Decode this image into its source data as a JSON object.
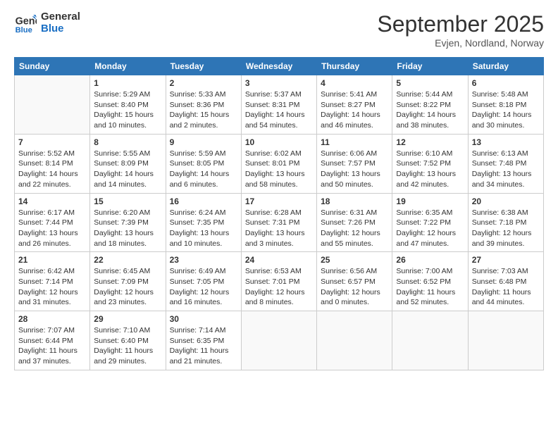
{
  "logo": {
    "text_general": "General",
    "text_blue": "Blue"
  },
  "header": {
    "month_title": "September 2025",
    "subtitle": "Evjen, Nordland, Norway"
  },
  "weekdays": [
    "Sunday",
    "Monday",
    "Tuesday",
    "Wednesday",
    "Thursday",
    "Friday",
    "Saturday"
  ],
  "weeks": [
    [
      {
        "day": "",
        "info": ""
      },
      {
        "day": "1",
        "info": "Sunrise: 5:29 AM\nSunset: 8:40 PM\nDaylight: 15 hours\nand 10 minutes."
      },
      {
        "day": "2",
        "info": "Sunrise: 5:33 AM\nSunset: 8:36 PM\nDaylight: 15 hours\nand 2 minutes."
      },
      {
        "day": "3",
        "info": "Sunrise: 5:37 AM\nSunset: 8:31 PM\nDaylight: 14 hours\nand 54 minutes."
      },
      {
        "day": "4",
        "info": "Sunrise: 5:41 AM\nSunset: 8:27 PM\nDaylight: 14 hours\nand 46 minutes."
      },
      {
        "day": "5",
        "info": "Sunrise: 5:44 AM\nSunset: 8:22 PM\nDaylight: 14 hours\nand 38 minutes."
      },
      {
        "day": "6",
        "info": "Sunrise: 5:48 AM\nSunset: 8:18 PM\nDaylight: 14 hours\nand 30 minutes."
      }
    ],
    [
      {
        "day": "7",
        "info": "Sunrise: 5:52 AM\nSunset: 8:14 PM\nDaylight: 14 hours\nand 22 minutes."
      },
      {
        "day": "8",
        "info": "Sunrise: 5:55 AM\nSunset: 8:09 PM\nDaylight: 14 hours\nand 14 minutes."
      },
      {
        "day": "9",
        "info": "Sunrise: 5:59 AM\nSunset: 8:05 PM\nDaylight: 14 hours\nand 6 minutes."
      },
      {
        "day": "10",
        "info": "Sunrise: 6:02 AM\nSunset: 8:01 PM\nDaylight: 13 hours\nand 58 minutes."
      },
      {
        "day": "11",
        "info": "Sunrise: 6:06 AM\nSunset: 7:57 PM\nDaylight: 13 hours\nand 50 minutes."
      },
      {
        "day": "12",
        "info": "Sunrise: 6:10 AM\nSunset: 7:52 PM\nDaylight: 13 hours\nand 42 minutes."
      },
      {
        "day": "13",
        "info": "Sunrise: 6:13 AM\nSunset: 7:48 PM\nDaylight: 13 hours\nand 34 minutes."
      }
    ],
    [
      {
        "day": "14",
        "info": "Sunrise: 6:17 AM\nSunset: 7:44 PM\nDaylight: 13 hours\nand 26 minutes."
      },
      {
        "day": "15",
        "info": "Sunrise: 6:20 AM\nSunset: 7:39 PM\nDaylight: 13 hours\nand 18 minutes."
      },
      {
        "day": "16",
        "info": "Sunrise: 6:24 AM\nSunset: 7:35 PM\nDaylight: 13 hours\nand 10 minutes."
      },
      {
        "day": "17",
        "info": "Sunrise: 6:28 AM\nSunset: 7:31 PM\nDaylight: 13 hours\nand 3 minutes."
      },
      {
        "day": "18",
        "info": "Sunrise: 6:31 AM\nSunset: 7:26 PM\nDaylight: 12 hours\nand 55 minutes."
      },
      {
        "day": "19",
        "info": "Sunrise: 6:35 AM\nSunset: 7:22 PM\nDaylight: 12 hours\nand 47 minutes."
      },
      {
        "day": "20",
        "info": "Sunrise: 6:38 AM\nSunset: 7:18 PM\nDaylight: 12 hours\nand 39 minutes."
      }
    ],
    [
      {
        "day": "21",
        "info": "Sunrise: 6:42 AM\nSunset: 7:14 PM\nDaylight: 12 hours\nand 31 minutes."
      },
      {
        "day": "22",
        "info": "Sunrise: 6:45 AM\nSunset: 7:09 PM\nDaylight: 12 hours\nand 23 minutes."
      },
      {
        "day": "23",
        "info": "Sunrise: 6:49 AM\nSunset: 7:05 PM\nDaylight: 12 hours\nand 16 minutes."
      },
      {
        "day": "24",
        "info": "Sunrise: 6:53 AM\nSunset: 7:01 PM\nDaylight: 12 hours\nand 8 minutes."
      },
      {
        "day": "25",
        "info": "Sunrise: 6:56 AM\nSunset: 6:57 PM\nDaylight: 12 hours\nand 0 minutes."
      },
      {
        "day": "26",
        "info": "Sunrise: 7:00 AM\nSunset: 6:52 PM\nDaylight: 11 hours\nand 52 minutes."
      },
      {
        "day": "27",
        "info": "Sunrise: 7:03 AM\nSunset: 6:48 PM\nDaylight: 11 hours\nand 44 minutes."
      }
    ],
    [
      {
        "day": "28",
        "info": "Sunrise: 7:07 AM\nSunset: 6:44 PM\nDaylight: 11 hours\nand 37 minutes."
      },
      {
        "day": "29",
        "info": "Sunrise: 7:10 AM\nSunset: 6:40 PM\nDaylight: 11 hours\nand 29 minutes."
      },
      {
        "day": "30",
        "info": "Sunrise: 7:14 AM\nSunset: 6:35 PM\nDaylight: 11 hours\nand 21 minutes."
      },
      {
        "day": "",
        "info": ""
      },
      {
        "day": "",
        "info": ""
      },
      {
        "day": "",
        "info": ""
      },
      {
        "day": "",
        "info": ""
      }
    ]
  ]
}
